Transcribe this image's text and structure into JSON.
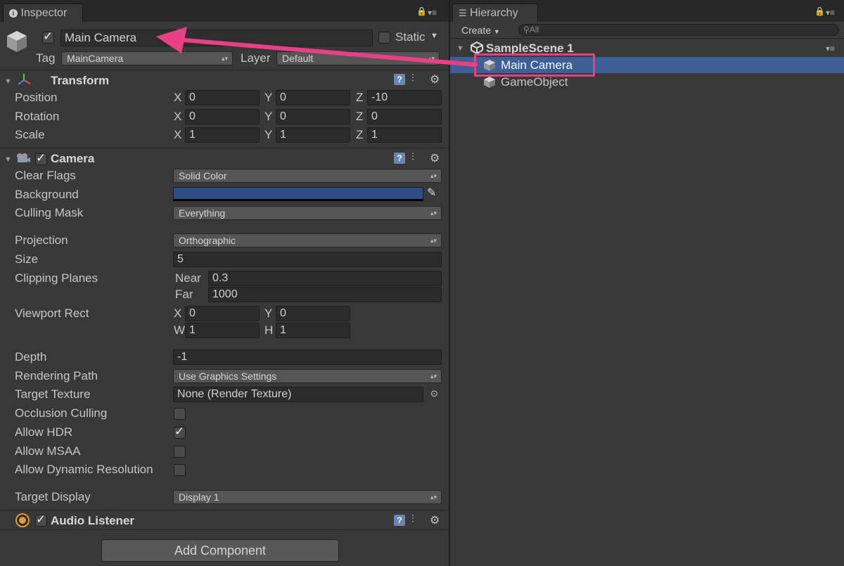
{
  "inspector": {
    "tab_label": "Inspector",
    "object_name": "Main Camera",
    "static_label": "Static",
    "tag_label": "Tag",
    "tag_value": "MainCamera",
    "layer_label": "Layer",
    "layer_value": "Default",
    "transform": {
      "title": "Transform",
      "rows": [
        {
          "label": "Position",
          "x": "0",
          "y": "0",
          "z": "-10"
        },
        {
          "label": "Rotation",
          "x": "0",
          "y": "0",
          "z": "0"
        },
        {
          "label": "Scale",
          "x": "1",
          "y": "1",
          "z": "1"
        }
      ],
      "axis_x": "X",
      "axis_y": "Y",
      "axis_z": "Z"
    },
    "camera": {
      "title": "Camera",
      "clear_flags_label": "Clear Flags",
      "clear_flags_value": "Solid Color",
      "background_label": "Background",
      "background_color": "#2f4d85",
      "culling_mask_label": "Culling Mask",
      "culling_mask_value": "Everything",
      "projection_label": "Projection",
      "projection_value": "Orthographic",
      "size_label": "Size",
      "size_value": "5",
      "clipping_label": "Clipping Planes",
      "near_label": "Near",
      "near_value": "0.3",
      "far_label": "Far",
      "far_value": "1000",
      "viewport_label": "Viewport Rect",
      "vp_x_label": "X",
      "vp_x": "0",
      "vp_y_label": "Y",
      "vp_y": "0",
      "vp_w_label": "W",
      "vp_w": "1",
      "vp_h_label": "H",
      "vp_h": "1",
      "depth_label": "Depth",
      "depth_value": "-1",
      "rendering_path_label": "Rendering Path",
      "rendering_path_value": "Use Graphics Settings",
      "target_texture_label": "Target Texture",
      "target_texture_value": "None (Render Texture)",
      "occlusion_label": "Occlusion Culling",
      "occlusion_checked": false,
      "hdr_label": "Allow HDR",
      "hdr_checked": true,
      "msaa_label": "Allow MSAA",
      "msaa_checked": false,
      "dynres_label": "Allow Dynamic Resolution",
      "dynres_checked": false,
      "target_display_label": "Target Display",
      "target_display_value": "Display 1"
    },
    "audio_listener": {
      "title": "Audio Listener"
    },
    "add_component_label": "Add Component"
  },
  "hierarchy": {
    "tab_label": "Hierarchy",
    "create_label": "Create",
    "search_placeholder": "All",
    "scene_name": "SampleScene 1",
    "items": [
      {
        "label": "Main Camera",
        "selected": true
      },
      {
        "label": "GameObject",
        "selected": false
      }
    ]
  },
  "annotation": {
    "color": "#ea3f82"
  },
  "colors": {
    "selection": "#3e5f96",
    "panel": "#383838"
  }
}
